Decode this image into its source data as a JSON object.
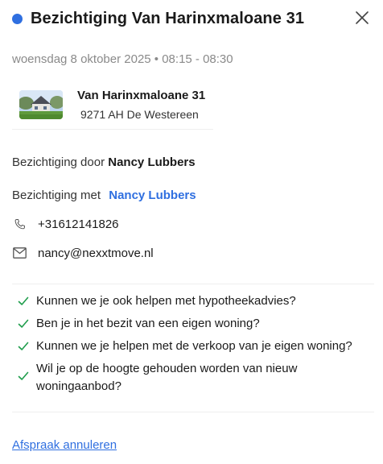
{
  "header": {
    "title": "Bezichtiging Van Harinxmaloane 31",
    "status_color": "#2f6fe0",
    "close_icon": "close-icon"
  },
  "datetime": "woensdag 8 oktober 2025 • 08:15 - 08:30",
  "property": {
    "street": "Van Harinxmaloane 31",
    "city": "9271 AH De Westereen"
  },
  "viewing": {
    "by_label": "Bezichtiging door",
    "by_name": "Nancy Lubbers",
    "with_label": "Bezichtiging met",
    "with_name": "Nancy Lubbers"
  },
  "contact": {
    "phone": "+31612141826",
    "email": "nancy@nexxtmove.nl"
  },
  "questions": [
    "Kunnen we je ook helpen met hypotheekadvies?",
    "Ben je in het bezit van een eigen woning?",
    "Kunnen we je helpen met de verkoop van je eigen woning?",
    "Wil je op de hoogte gehouden worden van nieuw woningaanbod?"
  ],
  "cancel_label": "Afspraak annuleren",
  "colors": {
    "accent": "#2f6fe0",
    "check": "#1f9d4c"
  }
}
